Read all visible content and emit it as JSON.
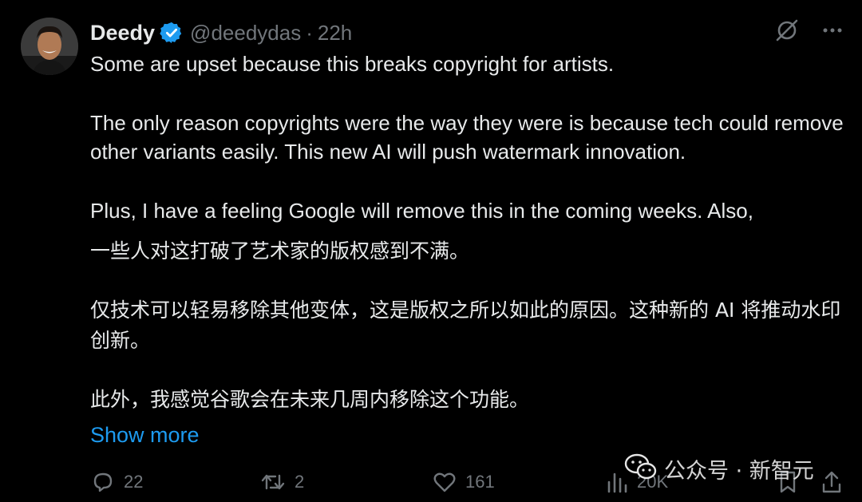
{
  "tweet": {
    "author_name": "Deedy",
    "handle": "@deedydas",
    "separator": "·",
    "time": "22h",
    "paragraphs_en": [
      "Some are upset because this breaks copyright for artists.",
      "The only reason copyrights were the way they were is because tech could remove other variants easily. This new AI will push watermark innovation.",
      "Plus, I have a feeling Google will remove this in the coming weeks. Also,"
    ],
    "paragraphs_zh": [
      "一些人对这打破了艺术家的版权感到不满。",
      "仅技术可以轻易移除其他变体，这是版权之所以如此的原因。这种新的 AI 将推动水印创新。",
      "此外，我感觉谷歌会在未来几周内移除这个功能。"
    ],
    "show_more": "Show more"
  },
  "actions": {
    "replies": "22",
    "reposts": "2",
    "likes": "161",
    "views": "20K"
  },
  "watermark": {
    "text": "公众号 · 新智元"
  },
  "colors": {
    "background": "#000000",
    "text": "#e7e9ea",
    "secondary": "#71767b",
    "accent": "#1d9bf0"
  },
  "icons": [
    "verified-badge-icon",
    "grok-icon",
    "more-icon",
    "reply-icon",
    "repost-icon",
    "like-icon",
    "views-icon",
    "bookmark-icon",
    "share-icon",
    "wechat-icon"
  ]
}
